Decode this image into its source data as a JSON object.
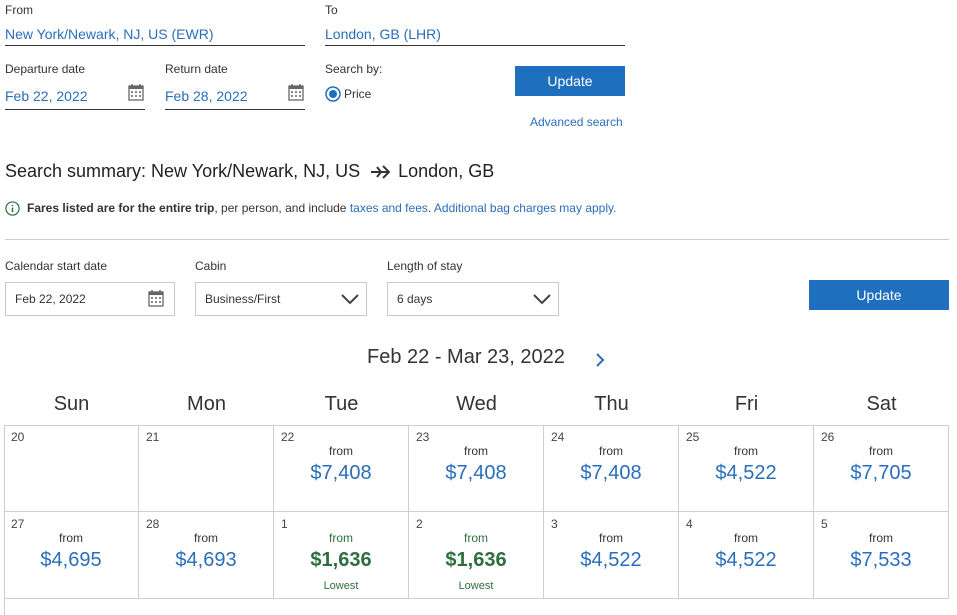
{
  "search": {
    "from_label": "From",
    "from_value": "New York/Newark, NJ, US (EWR)",
    "to_label": "To",
    "to_value": "London, GB (LHR)",
    "departure_label": "Departure date",
    "departure_value": "Feb 22, 2022",
    "return_label": "Return date",
    "return_value": "Feb 28, 2022",
    "search_by_label": "Search by:",
    "search_by_option": "Price",
    "update_label": "Update",
    "advanced_label": "Advanced search"
  },
  "summary": {
    "title_prefix": "Search summary:",
    "origin": "New York/Newark, NJ, US",
    "destination": "London, GB",
    "note_start": "Fares listed are for the entire trip",
    "note_mid": ", per person, and include ",
    "note_link1": "taxes and fees",
    "note_sep": ". ",
    "note_link2": "Additional bag charges may apply."
  },
  "filters": {
    "start_date_label": "Calendar start date",
    "start_date_value": "Feb 22, 2022",
    "cabin_label": "Cabin",
    "cabin_value": "Business/First",
    "stay_label": "Length of stay",
    "stay_value": "6 days",
    "update_label": "Update"
  },
  "calendar": {
    "range_title": "Feb 22 - Mar 23, 2022",
    "weekdays": [
      "Sun",
      "Mon",
      "Tue",
      "Wed",
      "Thu",
      "Fri",
      "Sat"
    ],
    "from_text": "from",
    "lowest_text": "Lowest",
    "weeks": [
      [
        {
          "day": "20",
          "price": ""
        },
        {
          "day": "21",
          "price": ""
        },
        {
          "day": "22",
          "price": "$7,408"
        },
        {
          "day": "23",
          "price": "$7,408"
        },
        {
          "day": "24",
          "price": "$7,408"
        },
        {
          "day": "25",
          "price": "$4,522"
        },
        {
          "day": "26",
          "price": "$7,705"
        }
      ],
      [
        {
          "day": "27",
          "price": "$4,695"
        },
        {
          "day": "28",
          "price": "$4,693"
        },
        {
          "day": "1",
          "price": "$1,636",
          "lowest": true
        },
        {
          "day": "2",
          "price": "$1,636",
          "lowest": true
        },
        {
          "day": "3",
          "price": "$4,522"
        },
        {
          "day": "4",
          "price": "$4,522"
        },
        {
          "day": "5",
          "price": "$7,533"
        }
      ]
    ]
  },
  "colors": {
    "accent": "#1f6fbf",
    "link": "#2a6ebb",
    "lowest": "#2f6e3e"
  },
  "icons": [
    "calendar-icon",
    "radio-selected-icon",
    "airplane-icon",
    "info-icon",
    "chevron-down-icon",
    "chevron-right-icon"
  ]
}
